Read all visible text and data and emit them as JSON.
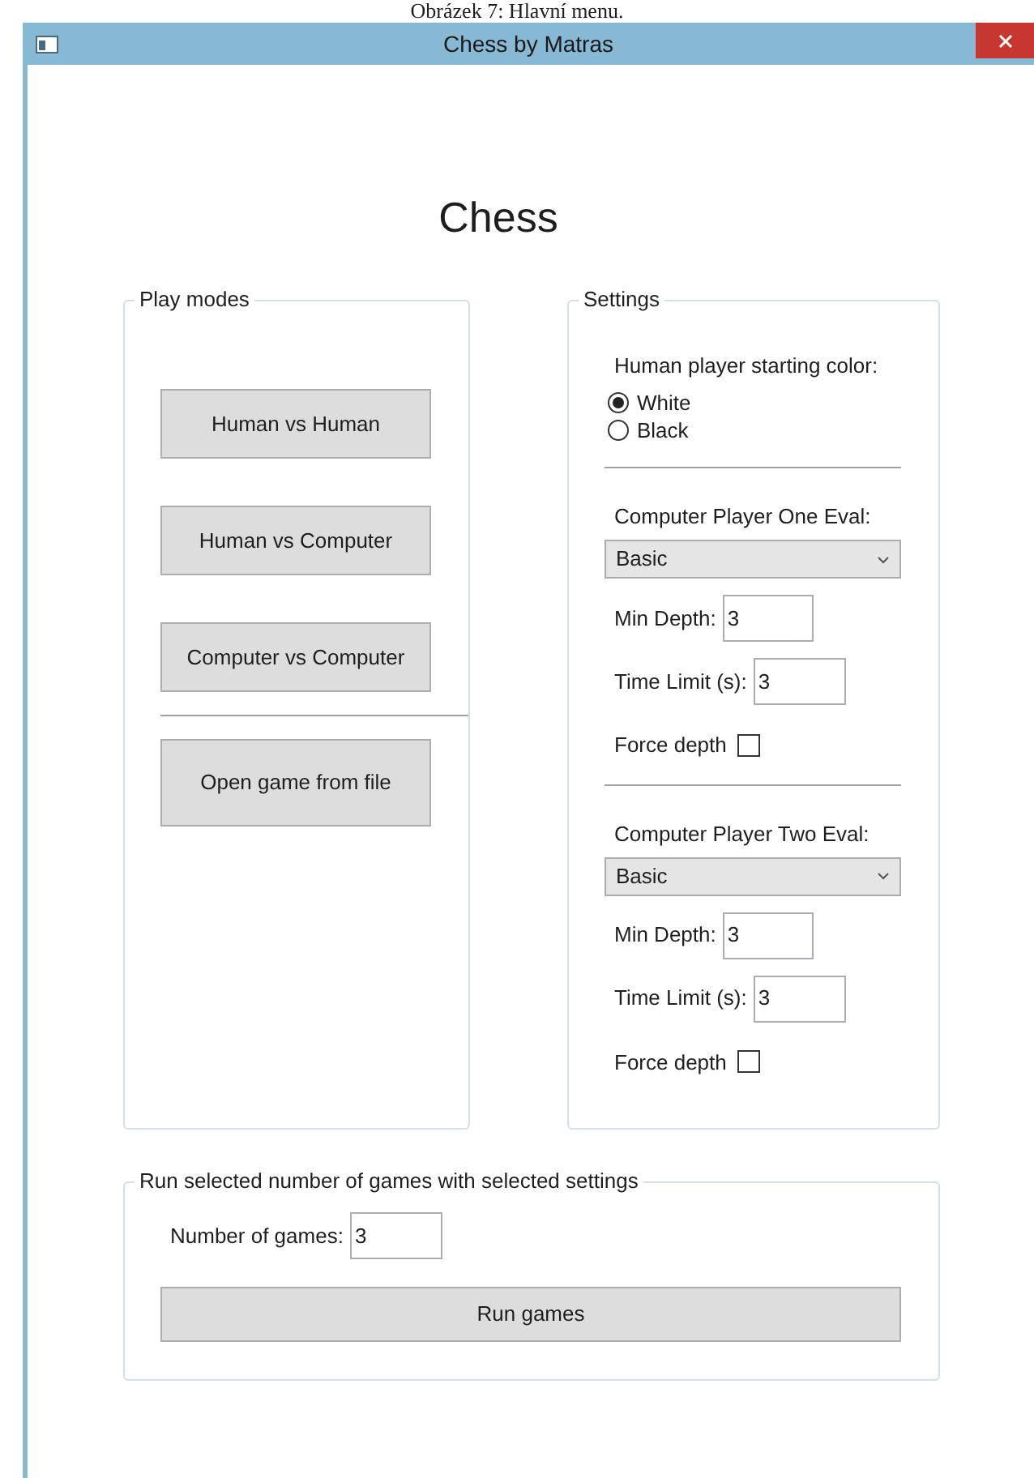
{
  "caption": "Obrázek 7: Hlavní menu.",
  "window": {
    "title": "Chess by Matras"
  },
  "heading": "Chess",
  "play_modes": {
    "title": "Play modes",
    "buttons": [
      "Human vs Human",
      "Human vs Computer",
      "Computer vs Computer",
      "Open game from file"
    ]
  },
  "settings": {
    "title": "Settings",
    "starting_color_label": "Human player starting color:",
    "colors": [
      {
        "label": "White",
        "selected": true
      },
      {
        "label": "Black",
        "selected": false
      }
    ],
    "players": [
      {
        "eval_label": "Computer Player One Eval:",
        "eval_value": "Basic",
        "min_depth_label": "Min Depth:",
        "min_depth_value": "3",
        "time_limit_label": "Time Limit (s):",
        "time_limit_value": "3",
        "force_depth_label": "Force depth",
        "force_depth_checked": false
      },
      {
        "eval_label": "Computer Player Two Eval:",
        "eval_value": "Basic",
        "min_depth_label": "Min Depth:",
        "min_depth_value": "3",
        "time_limit_label": "Time Limit (s):",
        "time_limit_value": "3",
        "force_depth_label": "Force depth",
        "force_depth_checked": false
      }
    ]
  },
  "batch": {
    "title": "Run selected number of games with selected settings",
    "games_label": "Number of games:",
    "games_value": "3",
    "run_button": "Run games"
  }
}
